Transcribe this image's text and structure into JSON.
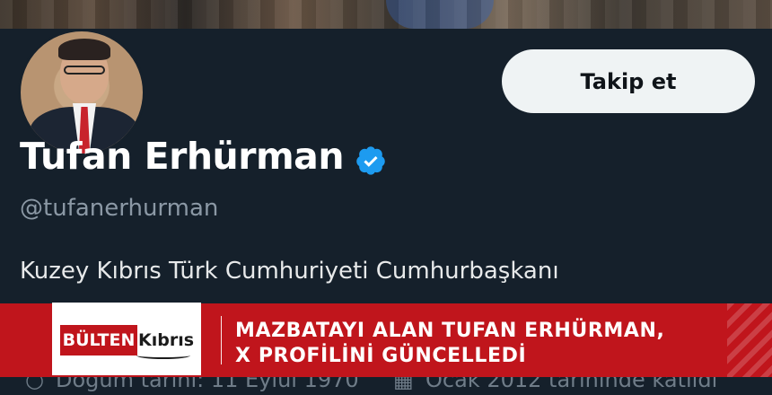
{
  "profile": {
    "name": "Tufan Erhürman",
    "handle": "@tufanerhurman",
    "bio": "Kuzey Kıbrıs Türk Cumhuriyeti Cumhurbaşkanı",
    "follow_label": "Takip et",
    "verified_color": "#1d9bf0",
    "birth_date": "Doğum tarihi: 11 Eylül 1970",
    "joined": "Ocak 2012 tarihinde katıldı"
  },
  "overlay": {
    "logo_part1": "BÜLTEN",
    "logo_part2": "Kıbrıs",
    "headline_line1": "MAZBATAYI ALAN TUFAN ERHÜRMAN,",
    "headline_line2": "X PROFİLİNİ GÜNCELLEDİ",
    "accent_color": "#c0151c"
  },
  "icons": [
    "verified-badge-icon",
    "birthday-icon",
    "calendar-icon"
  ]
}
